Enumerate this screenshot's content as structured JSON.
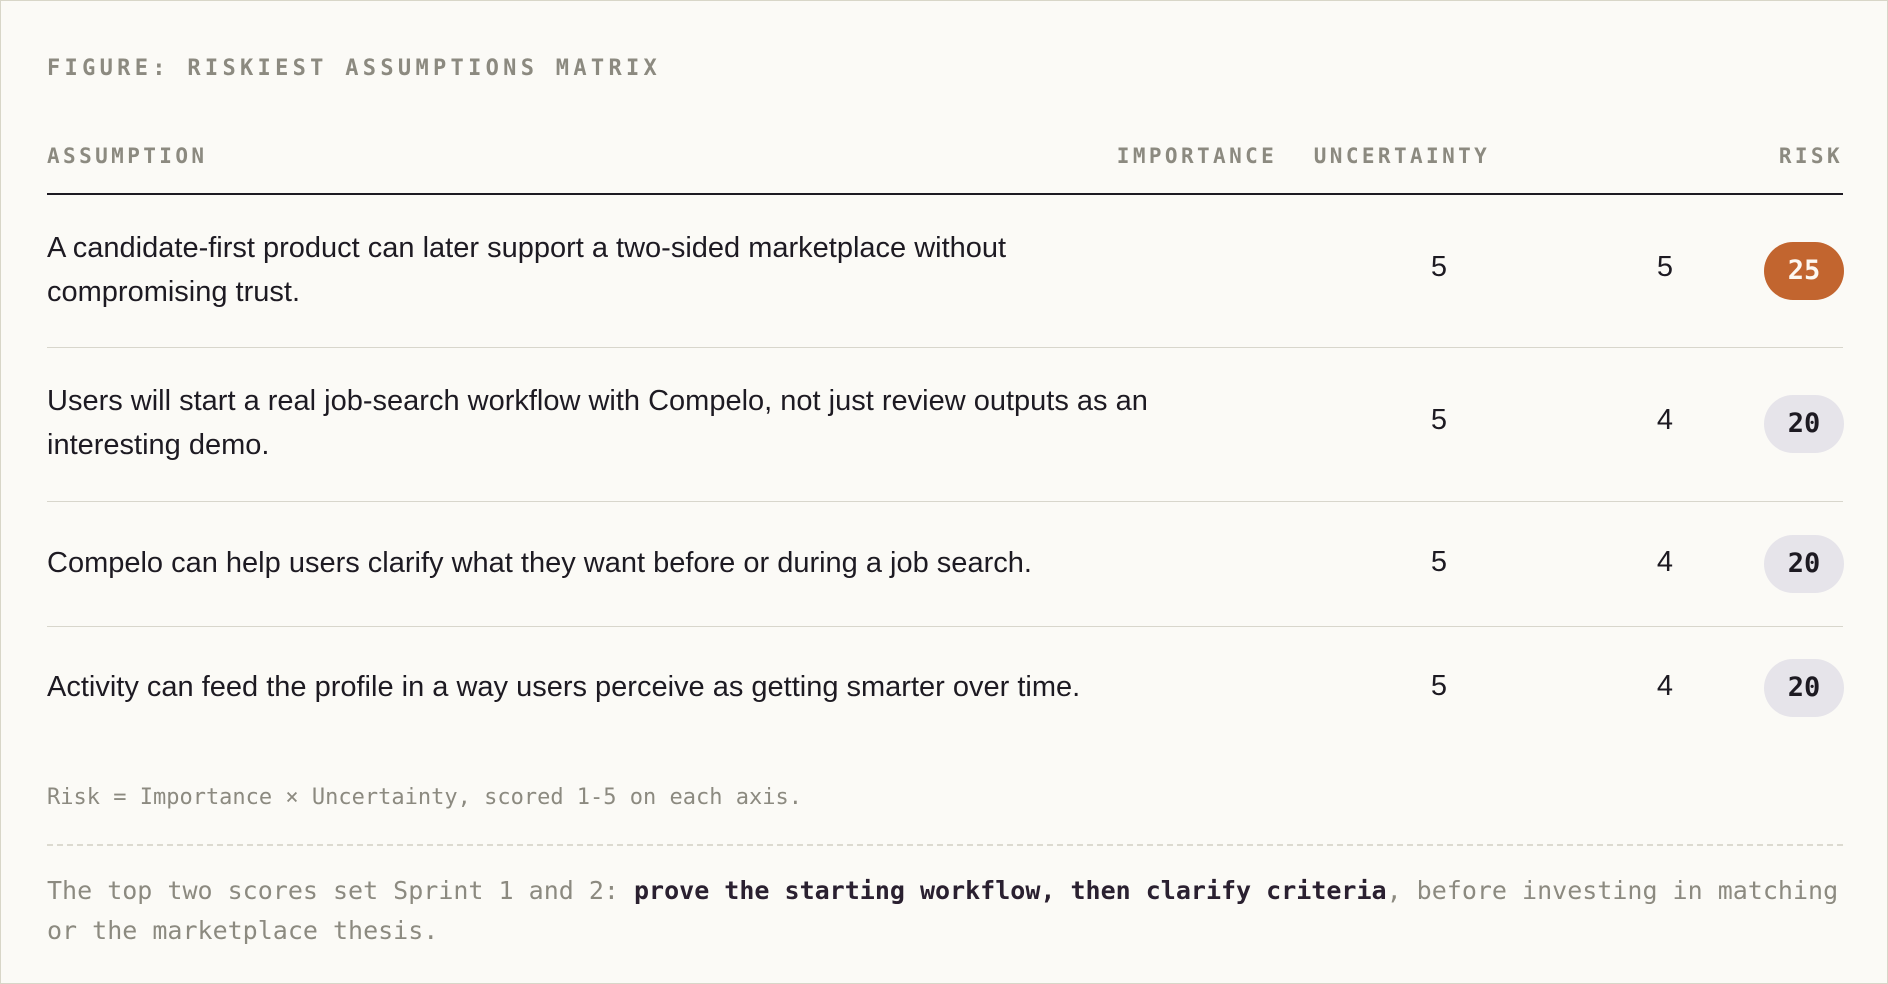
{
  "figure": {
    "title": "FIGURE: RISKIEST ASSUMPTIONS MATRIX"
  },
  "table": {
    "columns": {
      "assumption": "ASSUMPTION",
      "importance": "IMPORTANCE",
      "uncertainty": "UNCERTAINTY",
      "risk": "RISK"
    },
    "rows": [
      {
        "assumption": "A candidate-first product can later support a two-sided marketplace without compromising trust.",
        "importance": "5",
        "uncertainty": "5",
        "risk": "25"
      },
      {
        "assumption": "Users will start a real job-search workflow with Compelo, not just review outputs as an interesting demo.",
        "importance": "5",
        "uncertainty": "4",
        "risk": "20"
      },
      {
        "assumption": "Compelo can help users clarify what they want before or during a job search.",
        "importance": "5",
        "uncertainty": "4",
        "risk": "20"
      },
      {
        "assumption": "Activity can feed the profile in a way users perceive as getting smarter over time.",
        "importance": "5",
        "uncertainty": "4",
        "risk": "20"
      }
    ]
  },
  "footer": {
    "formula": "Risk = Importance × Uncertainty, scored 1-5 on each axis.",
    "note_prefix": "The top two scores set Sprint 1 and 2: ",
    "note_emphasis": "prove the starting workflow, then clarify criteria",
    "note_suffix": ", before investing in matching or the marketplace thesis."
  },
  "colors": {
    "highlight_pill": "#c2652f",
    "default_pill": "#e6e4ea",
    "text": "#1d1a22",
    "muted": "#8c8a80",
    "background": "#fbfaf6"
  }
}
